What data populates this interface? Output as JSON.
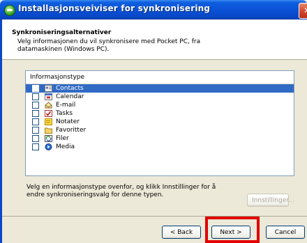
{
  "window": {
    "title": "Installasjonsveiviser for synkronisering",
    "close_glyph": "✕"
  },
  "header": {
    "title": "Synkroniseringsalternativer",
    "description": "Velg informasjonen du vil synkronisere med Pocket PC, fra datamaskinen (Windows PC)."
  },
  "list": {
    "column_header": "Informasjonstype",
    "items": [
      {
        "label": "Contacts",
        "icon": "contacts-icon",
        "selected": true,
        "checked": false
      },
      {
        "label": "Calendar",
        "icon": "calendar-icon",
        "selected": false,
        "checked": false
      },
      {
        "label": "E-mail",
        "icon": "email-icon",
        "selected": false,
        "checked": false
      },
      {
        "label": "Tasks",
        "icon": "tasks-icon",
        "selected": false,
        "checked": false
      },
      {
        "label": "Notater",
        "icon": "notes-icon",
        "selected": false,
        "checked": false
      },
      {
        "label": "Favoritter",
        "icon": "favorites-folder-icon",
        "selected": false,
        "checked": false
      },
      {
        "label": "Filer",
        "icon": "files-icon",
        "selected": false,
        "checked": false
      },
      {
        "label": "Media",
        "icon": "media-icon",
        "selected": false,
        "checked": false
      }
    ]
  },
  "info_text": "Velg en informasjonstype ovenfor, og klikk Innstillinger for å endre synkroniseringsvalg for denne typen.",
  "buttons": {
    "settings": "Innstillinger...",
    "back": "< Back",
    "next": "Next >",
    "cancel": "Cancel"
  },
  "colors": {
    "selection": "#316ac5",
    "titlebar": "#0a52d6",
    "highlight": "#e00000"
  }
}
